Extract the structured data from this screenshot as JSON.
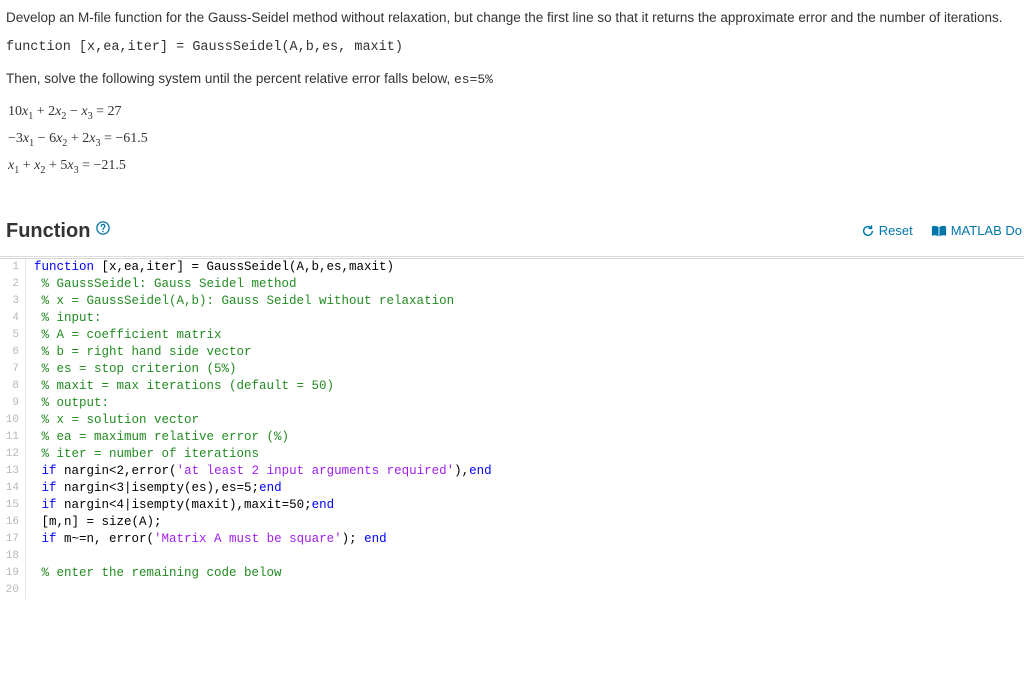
{
  "problem": {
    "p1": "Develop an M-file function for the Gauss-Seidel method without relaxation, but change the first line so that it returns the approximate error and the number of iterations.",
    "code_line": "function [x,ea,iter] = GaussSeidel(A,b,es, maxit)",
    "p2_prefix": "Then, solve the following system until the percent relative error falls below,  ",
    "p2_es": "es=5%",
    "equations": [
      "10x₁ + 2x₂ − x₃ = 27",
      "−3x₁ − 6x₂ + 2x₃ = −61.5",
      "x₁ + x₂ + 5x₃ = −21.5"
    ]
  },
  "section": {
    "title": "Function",
    "reset_label": "Reset",
    "matlab_label": "MATLAB Do"
  },
  "code": {
    "lines": [
      {
        "n": "1",
        "tokens": [
          {
            "t": "function ",
            "c": "kw"
          },
          {
            "t": "[x,ea,iter] = GaussSeidel(A,b,es,maxit)",
            "c": ""
          }
        ]
      },
      {
        "n": "2",
        "tokens": [
          {
            "t": " % GaussSeidel: Gauss Seidel method",
            "c": "com"
          }
        ]
      },
      {
        "n": "3",
        "tokens": [
          {
            "t": " % x = GaussSeidel(A,b): Gauss Seidel without relaxation",
            "c": "com"
          }
        ]
      },
      {
        "n": "4",
        "tokens": [
          {
            "t": " % input:",
            "c": "com"
          }
        ]
      },
      {
        "n": "5",
        "tokens": [
          {
            "t": " % A = coefficient matrix",
            "c": "com"
          }
        ]
      },
      {
        "n": "6",
        "tokens": [
          {
            "t": " % b = right hand side vector",
            "c": "com"
          }
        ]
      },
      {
        "n": "7",
        "tokens": [
          {
            "t": " % es = stop criterion (5%)",
            "c": "com"
          }
        ]
      },
      {
        "n": "8",
        "tokens": [
          {
            "t": " % maxit = max iterations (default = 50)",
            "c": "com"
          }
        ]
      },
      {
        "n": "9",
        "tokens": [
          {
            "t": " % output:",
            "c": "com"
          }
        ]
      },
      {
        "n": "10",
        "tokens": [
          {
            "t": " % x = solution vector",
            "c": "com"
          }
        ]
      },
      {
        "n": "11",
        "tokens": [
          {
            "t": " % ea = maximum relative error (%)",
            "c": "com"
          }
        ]
      },
      {
        "n": "12",
        "tokens": [
          {
            "t": " % iter = number of iterations",
            "c": "com"
          }
        ]
      },
      {
        "n": "13",
        "tokens": [
          {
            "t": " ",
            "c": ""
          },
          {
            "t": "if ",
            "c": "kw"
          },
          {
            "t": "nargin<2,error(",
            "c": ""
          },
          {
            "t": "'at least 2 input arguments required'",
            "c": "str"
          },
          {
            "t": "),",
            "c": ""
          },
          {
            "t": "end",
            "c": "kw"
          }
        ]
      },
      {
        "n": "14",
        "tokens": [
          {
            "t": " ",
            "c": ""
          },
          {
            "t": "if ",
            "c": "kw"
          },
          {
            "t": "nargin<3|isempty(es),es=5;",
            "c": ""
          },
          {
            "t": "end",
            "c": "kw"
          }
        ]
      },
      {
        "n": "15",
        "tokens": [
          {
            "t": " ",
            "c": ""
          },
          {
            "t": "if ",
            "c": "kw"
          },
          {
            "t": "nargin<4|isempty(maxit),maxit=50;",
            "c": ""
          },
          {
            "t": "end",
            "c": "kw"
          }
        ]
      },
      {
        "n": "16",
        "tokens": [
          {
            "t": " [m,n] = size(A);",
            "c": ""
          }
        ]
      },
      {
        "n": "17",
        "tokens": [
          {
            "t": " ",
            "c": ""
          },
          {
            "t": "if ",
            "c": "kw"
          },
          {
            "t": "m~=n, error(",
            "c": ""
          },
          {
            "t": "'Matrix A must be square'",
            "c": "str"
          },
          {
            "t": "); ",
            "c": ""
          },
          {
            "t": "end",
            "c": "kw"
          }
        ]
      },
      {
        "n": "18",
        "tokens": [
          {
            "t": "",
            "c": ""
          }
        ]
      },
      {
        "n": "19",
        "tokens": [
          {
            "t": " % enter the remaining code below",
            "c": "com"
          }
        ]
      },
      {
        "n": "20",
        "tokens": [
          {
            "t": "",
            "c": ""
          }
        ]
      }
    ]
  }
}
